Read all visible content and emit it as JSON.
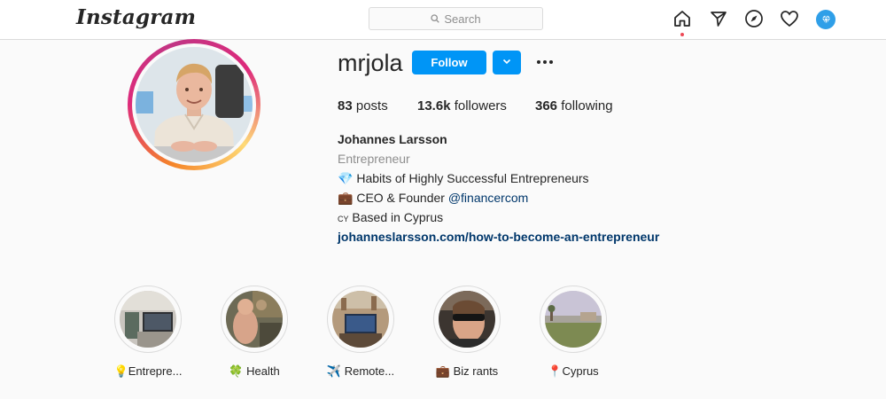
{
  "header": {
    "logo": "Instagram",
    "search_placeholder": "Search",
    "nav_icons": [
      "home-icon",
      "direct-icon",
      "explore-icon",
      "activity-icon",
      "profile-avatar"
    ]
  },
  "profile": {
    "username": "mrjola",
    "follow_label": "Follow",
    "stats": {
      "posts_count": "83",
      "posts_label": "posts",
      "followers_count": "13.6k",
      "followers_label": "followers",
      "following_count": "366",
      "following_label": "following"
    },
    "bio": {
      "name": "Johannes Larsson",
      "category": "Entrepreneur",
      "line1_emoji": "💎",
      "line1": "Habits of Highly Successful Entrepreneurs",
      "line2_emoji": "💼",
      "line2_prefix": "CEO & Founder",
      "line2_mention": "@financercom",
      "line3_flag": "CY",
      "line3": "Based in Cyprus",
      "link": "johanneslarsson.com/how-to-become-an-entrepreneur"
    }
  },
  "highlights": [
    {
      "emoji": "💡",
      "label": "Entrepre..."
    },
    {
      "emoji": "🍀",
      "label": "Health"
    },
    {
      "emoji": "✈️",
      "label": "Remote..."
    },
    {
      "emoji": "💼",
      "label": "Biz rants"
    },
    {
      "emoji": "📍",
      "label": "Cyprus"
    }
  ],
  "colors": {
    "accent": "#0095f6",
    "link": "#00376b",
    "muted": "#8e8e8e",
    "notification": "#ed4956"
  }
}
